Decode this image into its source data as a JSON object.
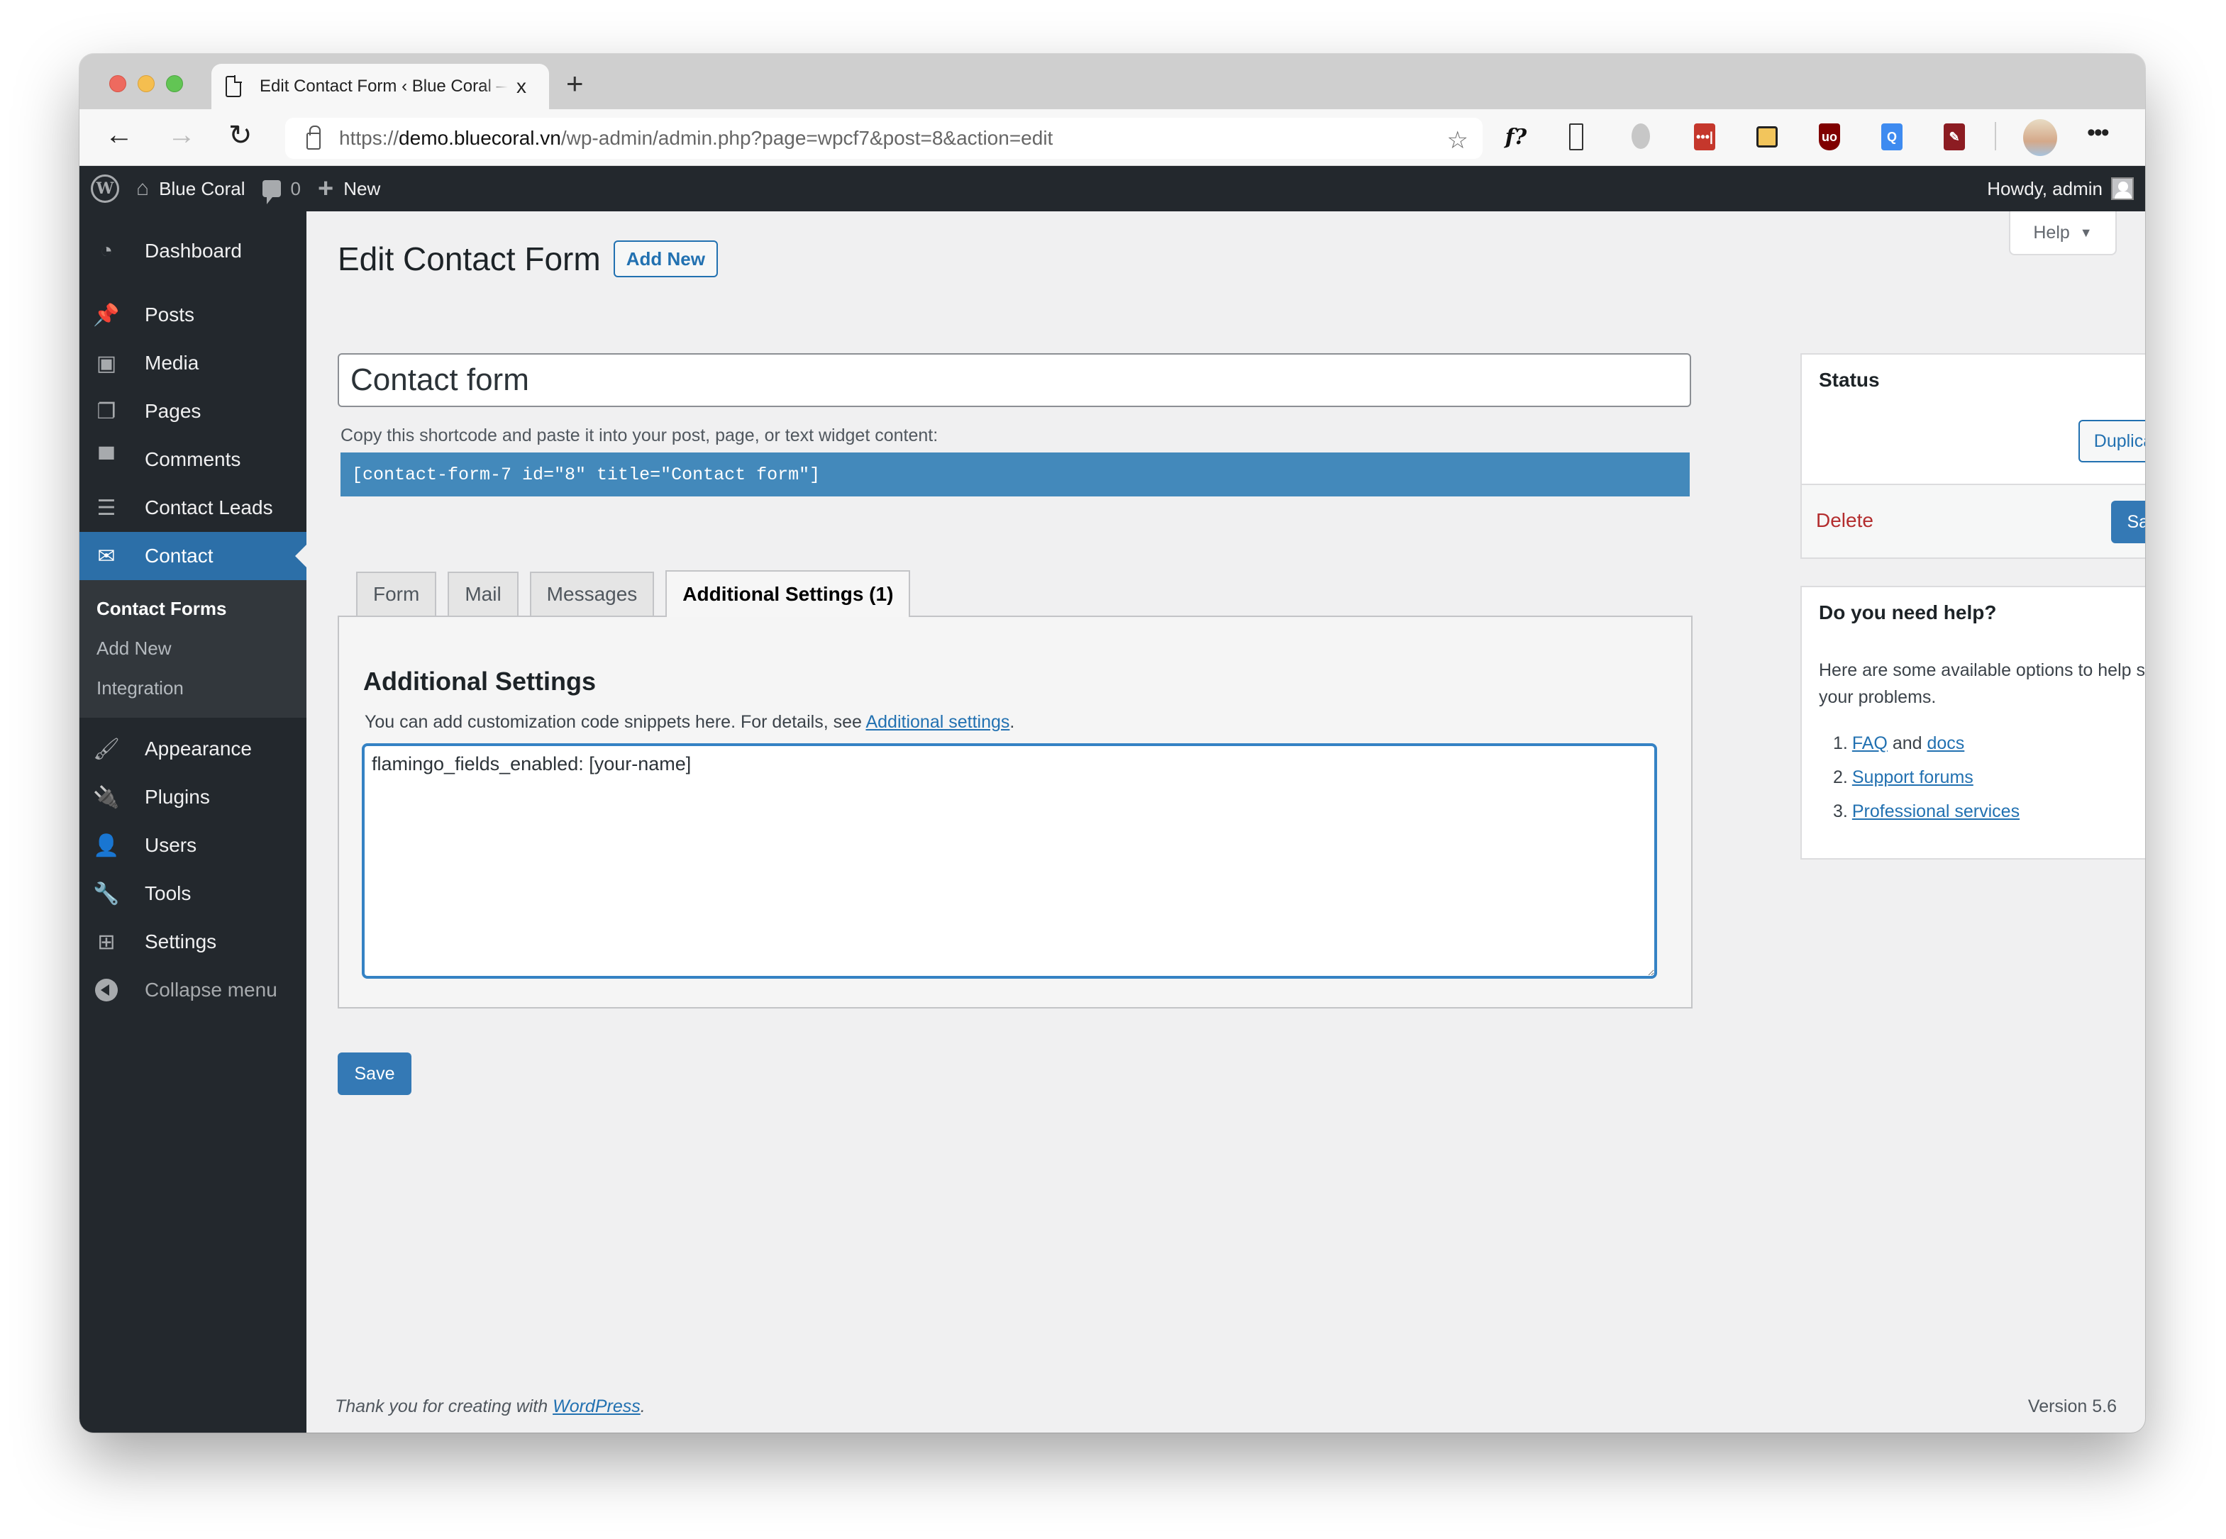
{
  "browser": {
    "tab_title": "Edit Contact Form ‹ Blue Coral — WordPress",
    "tab_close": "x",
    "new_tab": "+",
    "url_prefix": "https://",
    "url_host": "demo.bluecoral.vn",
    "url_path": "/wp-admin/admin.php?page=wpcf7&post=8&action=edit",
    "extensions": [
      "font-finder-icon",
      "reader-icon",
      "grey-ext-icon",
      "lastpass-icon",
      "yellow-ext-icon",
      "ublock-icon",
      "blue-ext-icon",
      "wrench-ext-icon"
    ],
    "ext_labels": {
      "fx": "f?",
      "lastpass": "•••|",
      "ublock": "uo",
      "blue": "Q",
      "wrench": "✎"
    },
    "more": "•••"
  },
  "adminbar": {
    "site_name": "Blue Coral",
    "comments_count": "0",
    "new_label": "New",
    "greeting": "Howdy, admin"
  },
  "sidebar": {
    "items": [
      {
        "label": "Dashboard",
        "icon": "dashboard-icon"
      },
      {
        "label": "Posts",
        "icon": "pin-icon"
      },
      {
        "label": "Media",
        "icon": "media-icon"
      },
      {
        "label": "Pages",
        "icon": "pages-icon"
      },
      {
        "label": "Comments",
        "icon": "comment-icon"
      },
      {
        "label": "Contact Leads",
        "icon": "leads-icon"
      },
      {
        "label": "Contact",
        "icon": "envelope-icon",
        "active": true
      }
    ],
    "submenu": [
      {
        "label": "Contact Forms",
        "current": true
      },
      {
        "label": "Add New"
      },
      {
        "label": "Integration"
      }
    ],
    "items_after": [
      {
        "label": "Appearance",
        "icon": "brush-icon"
      },
      {
        "label": "Plugins",
        "icon": "plug-icon"
      },
      {
        "label": "Users",
        "icon": "user-icon"
      },
      {
        "label": "Tools",
        "icon": "wrench-icon"
      },
      {
        "label": "Settings",
        "icon": "settings-icon"
      }
    ],
    "collapse_label": "Collapse menu"
  },
  "content": {
    "help_tab": "Help",
    "page_title": "Edit Contact Form",
    "add_new": "Add New",
    "form_title_value": "Contact form",
    "shortcode_label": "Copy this shortcode and paste it into your post, page, or text widget content:",
    "shortcode": "[contact-form-7 id=\"8\" title=\"Contact form\"]",
    "tabs": [
      {
        "label": "Form"
      },
      {
        "label": "Mail"
      },
      {
        "label": "Messages"
      },
      {
        "label": "Additional Settings (1)",
        "active": true
      }
    ],
    "panel": {
      "title": "Additional Settings",
      "desc_prefix": "You can add customization code snippets here. For details, see ",
      "desc_link": "Additional settings",
      "desc_suffix": ".",
      "textarea_value": "flamingo_fields_enabled: [your-name]"
    },
    "save_label": "Save"
  },
  "status_box": {
    "title": "Status",
    "duplicate": "Duplicate",
    "delete": "Delete",
    "save": "Save"
  },
  "help_box": {
    "title": "Do you need help?",
    "text": "Here are some available options to help solve your problems.",
    "items": [
      {
        "num": "1.",
        "link1": "FAQ",
        "mid": " and ",
        "link2": "docs"
      },
      {
        "num": "2.",
        "link1": "Support forums"
      },
      {
        "num": "3.",
        "link1": "Professional services"
      }
    ]
  },
  "footer": {
    "thanks_prefix": "Thank you for creating with ",
    "thanks_link": "WordPress",
    "thanks_suffix": ".",
    "version": "Version 5.6"
  },
  "colors": {
    "admin_bar": "#23282d",
    "active_menu": "#2c6fa8",
    "primary_button": "#3479b5",
    "shortcode_bg": "#4389bb",
    "delete": "#b32d2e",
    "link": "#2271b1"
  }
}
